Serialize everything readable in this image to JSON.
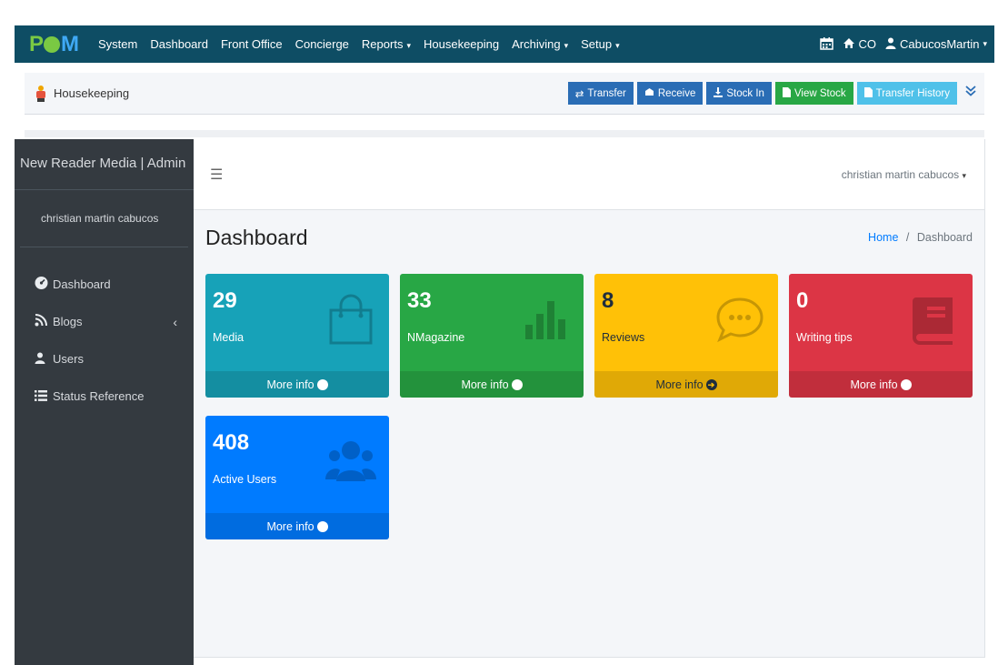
{
  "topnav": {
    "logo": "PAM",
    "items": [
      {
        "label": "System",
        "caret": false
      },
      {
        "label": "Dashboard",
        "caret": false
      },
      {
        "label": "Front Office",
        "caret": false
      },
      {
        "label": "Concierge",
        "caret": false
      },
      {
        "label": "Reports",
        "caret": true
      },
      {
        "label": "Housekeeping",
        "caret": false
      },
      {
        "label": "Archiving",
        "caret": true
      },
      {
        "label": "Setup",
        "caret": true
      }
    ],
    "home_label": "CO",
    "user_label": "CabucosMartin"
  },
  "subheader": {
    "title": "Housekeeping",
    "buttons": {
      "transfer": "Transfer",
      "receive": "Receive",
      "stock_in": "Stock In",
      "view_stock": "View Stock",
      "transfer_history": "Transfer History"
    }
  },
  "sidebar": {
    "brand": "New Reader Media | Admin",
    "user": "christian martin cabucos",
    "items": [
      {
        "label": "Dashboard",
        "icon": "tachometer-icon"
      },
      {
        "label": "Blogs",
        "icon": "rss-icon"
      },
      {
        "label": "Users",
        "icon": "user-icon"
      },
      {
        "label": "Status Reference",
        "icon": "list-icon"
      }
    ]
  },
  "main": {
    "user_dropdown": "christian martin cabucos",
    "page_title": "Dashboard",
    "breadcrumb": {
      "home": "Home",
      "separator": "/",
      "current": "Dashboard"
    },
    "boxes": [
      {
        "value": "29",
        "label": "Media",
        "more": "More info",
        "icon": "shopping-bag-icon"
      },
      {
        "value": "33",
        "label": "NMagazine",
        "more": "More info",
        "icon": "bar-chart-icon"
      },
      {
        "value": "8",
        "label": "Reviews",
        "more": "More info",
        "icon": "chat-bubble-icon"
      },
      {
        "value": "0",
        "label": "Writing tips",
        "more": "More info",
        "icon": "book-icon"
      },
      {
        "value": "408",
        "label": "Active Users",
        "more": "More info",
        "icon": "users-icon"
      }
    ]
  },
  "colors": {
    "topnav": "#0e4d64",
    "sidebar": "#343a40",
    "teal": "#17a2b8",
    "green": "#28a745",
    "yellow": "#ffc107",
    "red": "#dc3545",
    "blue": "#007bff"
  }
}
